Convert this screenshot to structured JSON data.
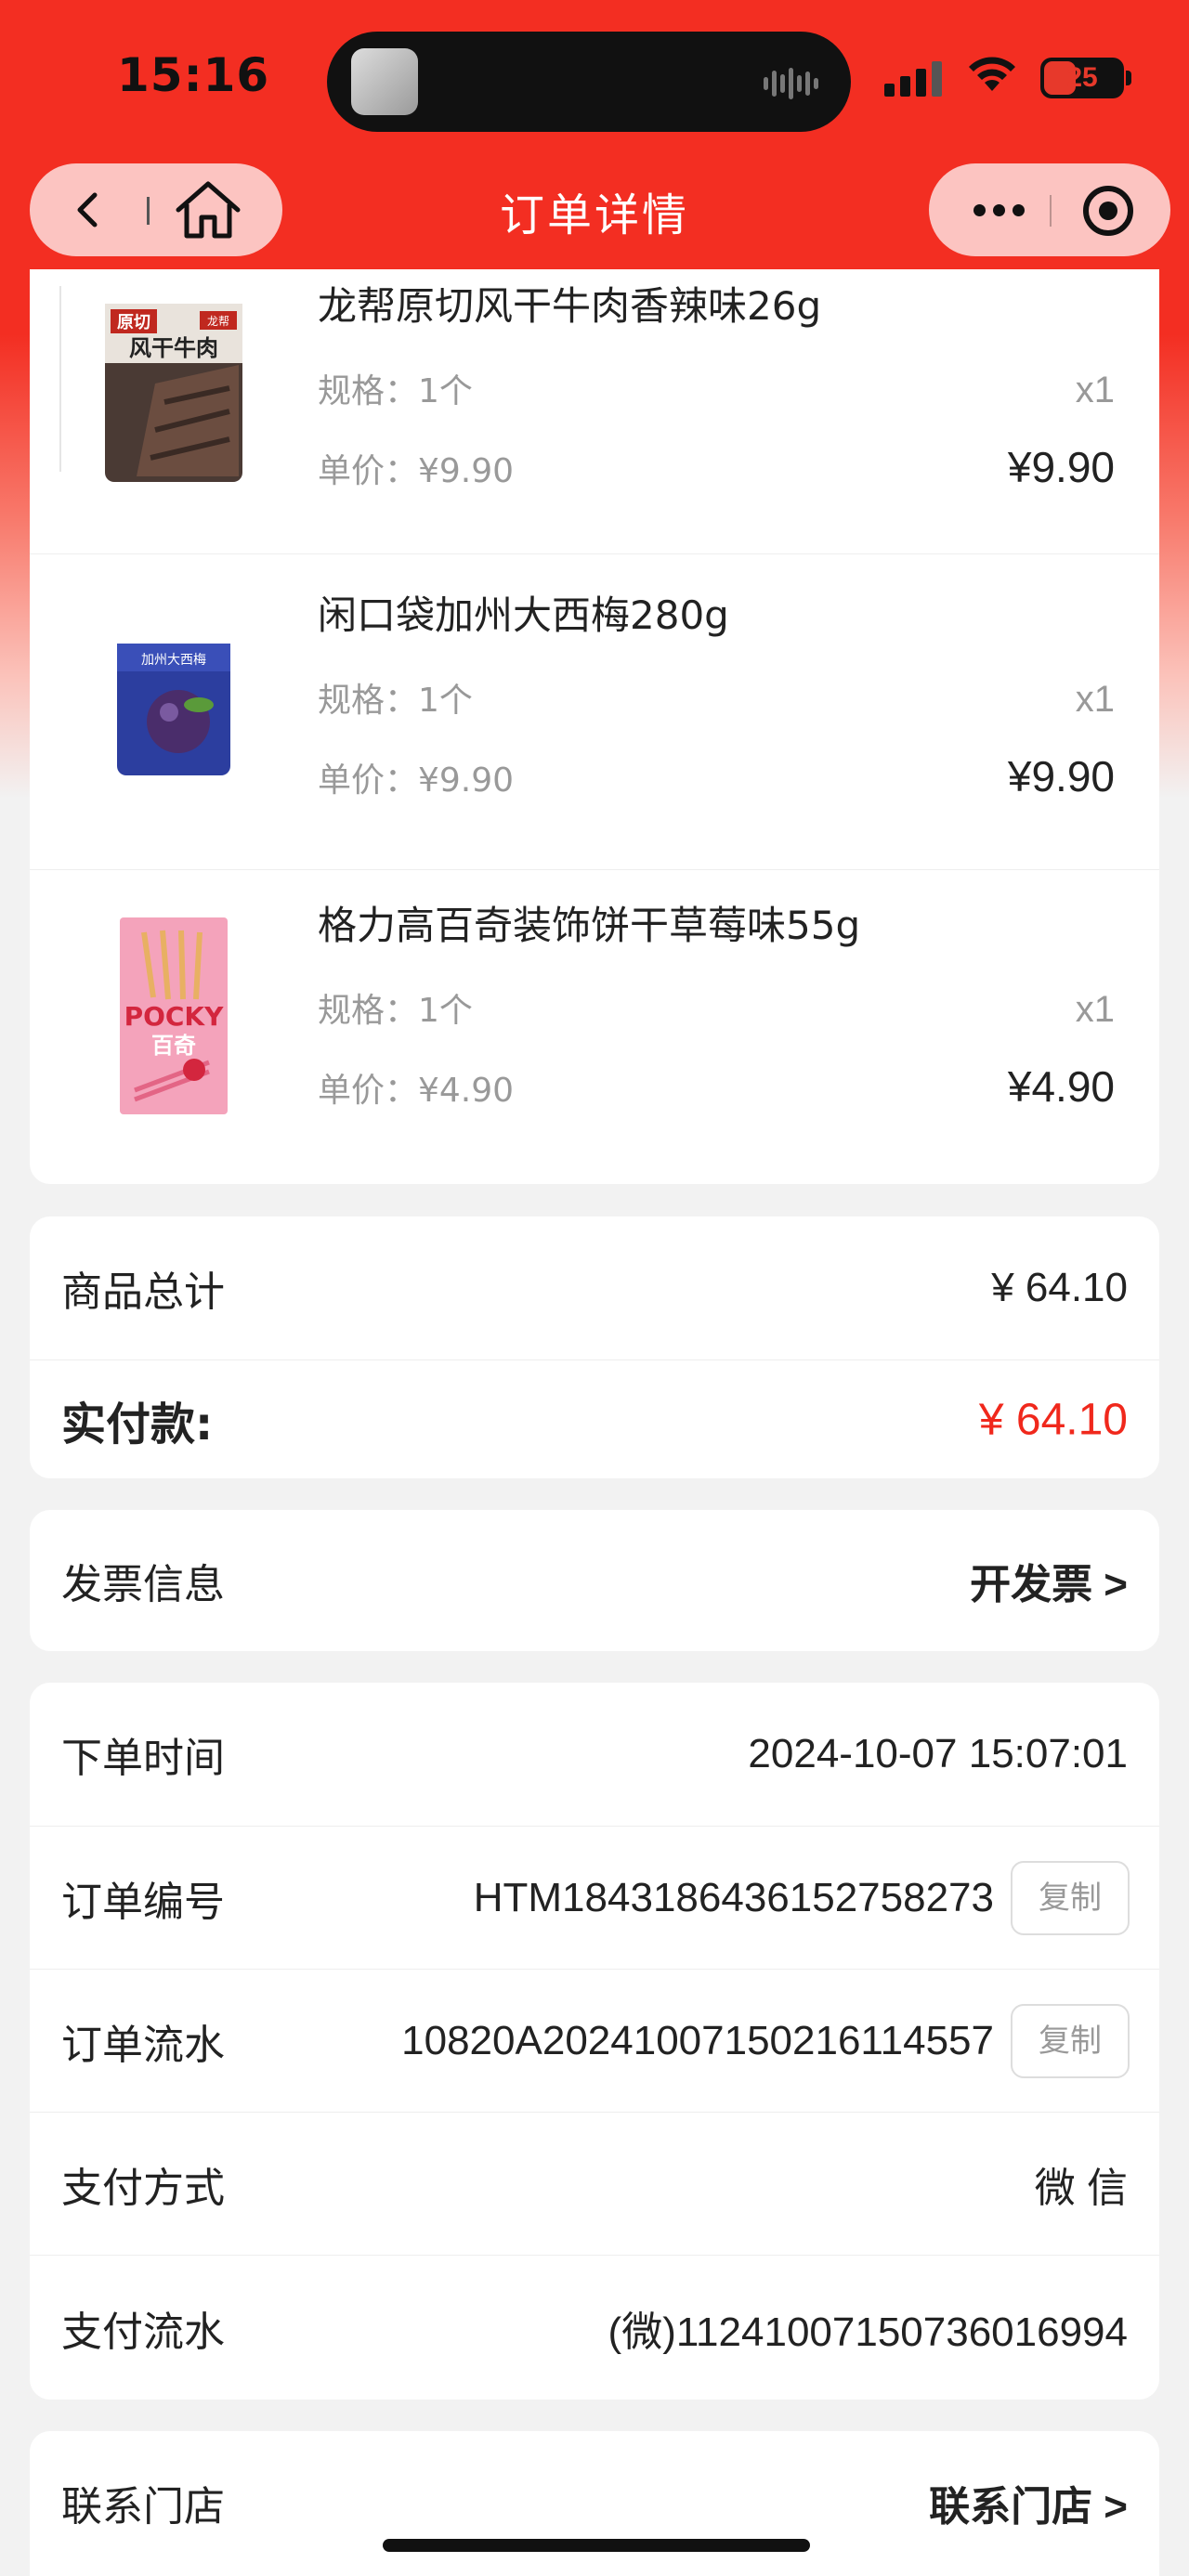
{
  "status_bar": {
    "time": "15:16",
    "battery": "25"
  },
  "nav": {
    "title": "订单详情"
  },
  "products": [
    {
      "name": "龙帮原切风干牛肉香辣味26g",
      "spec": "规格：1个",
      "unit_price": "单价：¥9.90",
      "qty": "x1",
      "total": "¥9.90",
      "package_text": [
        "龙帮",
        "原切",
        "风干牛肉"
      ]
    },
    {
      "name": "闲口袋加州大西梅280g",
      "spec": "规格：1个",
      "unit_price": "单价：¥9.90",
      "qty": "x1",
      "total": "¥9.90",
      "package_text": [
        "加州大西梅"
      ]
    },
    {
      "name": "格力高百奇装饰饼干草莓味55g",
      "spec": "规格：1个",
      "unit_price": "单价：¥4.90",
      "qty": "x1",
      "total": "¥4.90",
      "package_text": [
        "POCKY",
        "百奇"
      ]
    }
  ],
  "summary": {
    "subtotal_label": "商品总计",
    "subtotal_value": "¥ 64.10",
    "paid_label": "实付款:",
    "paid_value": "¥ 64.10"
  },
  "invoice": {
    "label": "发票信息",
    "action": "开发票 >"
  },
  "order_info": {
    "time_label": "下单时间",
    "time_value": "2024-10-07 15:07:01",
    "number_label": "订单编号",
    "number_value": "HTM1843186436152758273",
    "flow_label": "订单流水",
    "flow_value": "10820A20241007150216114557",
    "copy_label": "复制",
    "pay_method_label": "支付方式",
    "pay_method_value": "微 信",
    "pay_flow_label": "支付流水",
    "pay_flow_value": "(微)11241007150736016994"
  },
  "contact": {
    "label": "联系门店",
    "action": "联系门店 >"
  },
  "colors": {
    "brand_red": "#f32e22",
    "price_red": "#f0281c",
    "background": "#f2f2f2"
  },
  "icons": [
    "back-arrow-icon",
    "home-icon",
    "more-dots-icon",
    "close-target-icon"
  ]
}
